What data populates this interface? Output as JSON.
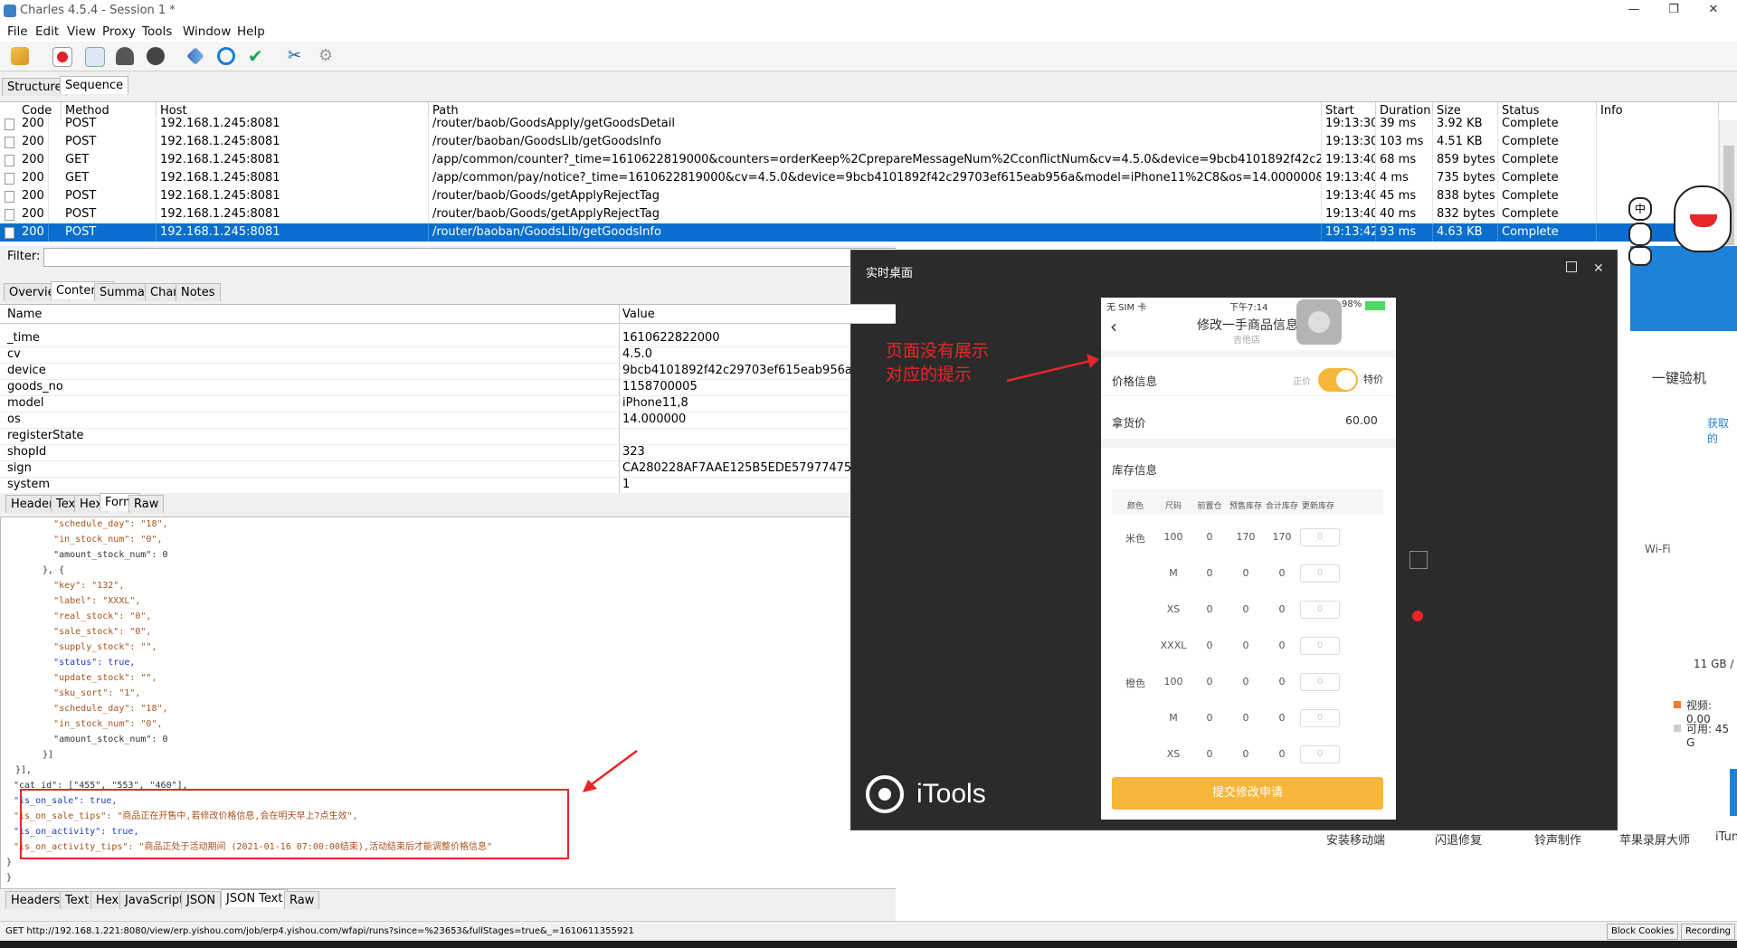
{
  "window": {
    "title": "Charles 4.5.4 - Session 1 *"
  },
  "menu": [
    "File",
    "Edit",
    "View",
    "Proxy",
    "Tools",
    "Window",
    "Help"
  ],
  "tabs": {
    "structure": "Structure",
    "sequence": "Sequence"
  },
  "columns": [
    "Code",
    "Method",
    "Host",
    "Path",
    "Start",
    "Duration",
    "Size",
    "Status",
    "Info"
  ],
  "rows": [
    {
      "code": "200",
      "method": "POST",
      "host": "192.168.1.245:8081",
      "path": "/router/baob/GoodsApply/getGoodsDetail",
      "start": "19:13:30",
      "duration": "39 ms",
      "size": "3.92 KB",
      "status": "Complete",
      "info": ""
    },
    {
      "code": "200",
      "method": "POST",
      "host": "192.168.1.245:8081",
      "path": "/router/baoban/GoodsLib/getGoodsInfo",
      "start": "19:13:30",
      "duration": "103 ms",
      "size": "4.51 KB",
      "status": "Complete",
      "info": ""
    },
    {
      "code": "200",
      "method": "GET",
      "host": "192.168.1.245:8081",
      "path": "/app/common/counter?_time=1610622819000&counters=orderKeep%2CprepareMessageNum%2CconflictNum&cv=4.5.0&device=9bcb4101892f42c29703ef615eab9...",
      "start": "19:13:40",
      "duration": "68 ms",
      "size": "859 bytes",
      "status": "Complete",
      "info": ""
    },
    {
      "code": "200",
      "method": "GET",
      "host": "192.168.1.245:8081",
      "path": "/app/common/pay/notice?_time=1610622819000&cv=4.5.0&device=9bcb4101892f42c29703ef615eab956a&model=iPhone11%2C8&os=14.000000&paidType=INDEX...",
      "start": "19:13:40",
      "duration": "4 ms",
      "size": "735 bytes",
      "status": "Complete",
      "info": ""
    },
    {
      "code": "200",
      "method": "POST",
      "host": "192.168.1.245:8081",
      "path": "/router/baob/Goods/getApplyRejectTag",
      "start": "19:13:40",
      "duration": "45 ms",
      "size": "838 bytes",
      "status": "Complete",
      "info": ""
    },
    {
      "code": "200",
      "method": "POST",
      "host": "192.168.1.245:8081",
      "path": "/router/baob/Goods/getApplyRejectTag",
      "start": "19:13:40",
      "duration": "40 ms",
      "size": "832 bytes",
      "status": "Complete",
      "info": ""
    },
    {
      "code": "200",
      "method": "POST",
      "host": "192.168.1.245:8081",
      "path": "/router/baoban/GoodsLib/getGoodsInfo",
      "start": "19:13:42",
      "duration": "93 ms",
      "size": "4.63 KB",
      "status": "Complete",
      "info": ""
    }
  ],
  "filter_label": "Filter:",
  "detail_tabs": [
    "Overview",
    "Contents",
    "Summary",
    "Chart",
    "Notes"
  ],
  "form_header": {
    "name": "Name",
    "value": "Value"
  },
  "form_rows": [
    {
      "name": "_time",
      "value": "1610622822000"
    },
    {
      "name": "cv",
      "value": "4.5.0"
    },
    {
      "name": "device",
      "value": "9bcb4101892f42c29703ef615eab956a"
    },
    {
      "name": "goods_no",
      "value": "1158700005"
    },
    {
      "name": "model",
      "value": "iPhone11,8"
    },
    {
      "name": "os",
      "value": "14.000000"
    },
    {
      "name": "registerState",
      "value": ""
    },
    {
      "name": "shopId",
      "value": "323"
    },
    {
      "name": "sign",
      "value": "CA280228AF7AAE125B5EDE57977475AC"
    },
    {
      "name": "system",
      "value": "1"
    }
  ],
  "request_tabs": [
    "Headers",
    "Text",
    "Hex",
    "Form",
    "Raw"
  ],
  "response_tabs": [
    "Headers",
    "Text",
    "Hex",
    "JavaScript",
    "JSON",
    "JSON Text",
    "Raw"
  ],
  "json_lines": [
    "    \"schedule_day\": \"18\",",
    "    \"in_stock_num\": \"0\",",
    "    \"amount_stock_num\": 0",
    "  }, {",
    "    \"key\": \"132\",",
    "    \"label\": \"XXXL\",",
    "    \"real_stock\": \"0\",",
    "    \"sale_stock\": \"0\",",
    "    \"supply_stock\": \"\",",
    "    \"status\": true,",
    "    \"update_stock\": \"\",",
    "    \"sku_sort\": \"1\",",
    "    \"schedule_day\": \"18\",",
    "    \"in_stock_num\": \"0\",",
    "    \"amount_stock_num\": 0",
    "  }]",
    "}],",
    "\"cat_id\": [\"455\", \"553\", \"460\"],",
    "\"is_on_sale\": true,",
    "\"is_on_sale_tips\": \"商品正在开售中,若修改价格信息,会在明天早上7点生效\",",
    "\"is_on_activity\": true,",
    "\"is_on_activity_tips\": \"商品正处于活动期间 (2021-01-16 07:00:00结束),活动结束后才能调整价格信息\"",
    "}",
    "}"
  ],
  "status_bar": {
    "url": "GET http://192.168.1.221:8080/view/erp.yishou.com/job/erp4.yishou.com/wfapi/runs?since=%23653&fullStages=true&_=1610611355921",
    "block_cookies": "Block Cookies",
    "recording": "Recording"
  },
  "itools": {
    "title": "实时桌面",
    "annotation_line1": "页面没有展示",
    "annotation_line2": "对应的提示",
    "brand": "iTools",
    "phone": {
      "carrier": "无 SIM 卡",
      "time": "下午7:14",
      "battery": "98%",
      "page_title": "修改一手商品信息",
      "shop_name": "吉他店",
      "price_section": "价格信息",
      "toggle_left": "正价",
      "toggle_right": "特价",
      "cost_label": "拿货价",
      "cost_value": "60.00",
      "stock_section": "库存信息",
      "stock_headers": [
        "颜色",
        "尺码",
        "前置仓",
        "预售库存",
        "合计库存",
        "更新库存"
      ],
      "stock_rows": [
        {
          "color": "米色",
          "size": "100",
          "front": "0",
          "presale": "170",
          "total": "170",
          "update": "0"
        },
        {
          "color": "",
          "size": "M",
          "front": "0",
          "presale": "0",
          "total": "0",
          "update": "0"
        },
        {
          "color": "",
          "size": "XS",
          "front": "0",
          "presale": "0",
          "total": "0",
          "update": "0"
        },
        {
          "color": "",
          "size": "XXXL",
          "front": "0",
          "presale": "0",
          "total": "0",
          "update": "0"
        },
        {
          "color": "橙色",
          "size": "100",
          "front": "0",
          "presale": "0",
          "total": "0",
          "update": "0"
        },
        {
          "color": "",
          "size": "M",
          "front": "0",
          "presale": "0",
          "total": "0",
          "update": "0"
        },
        {
          "color": "",
          "size": "XS",
          "front": "0",
          "presale": "0",
          "total": "0",
          "update": "0"
        }
      ],
      "submit": "提交修改申请"
    }
  },
  "background_app": {
    "one_key_check": "一键验机",
    "storage": "11 GB /",
    "video": "视频: 0.00",
    "available": "可用: 45 G",
    "wifi": "Wi-Fi",
    "link1": "获取的",
    "tools": [
      "安装移动端",
      "闪退修复",
      "铃声制作",
      "苹果录屏大师",
      "iTun"
    ]
  },
  "icons": {
    "chinese_ime": "中"
  }
}
